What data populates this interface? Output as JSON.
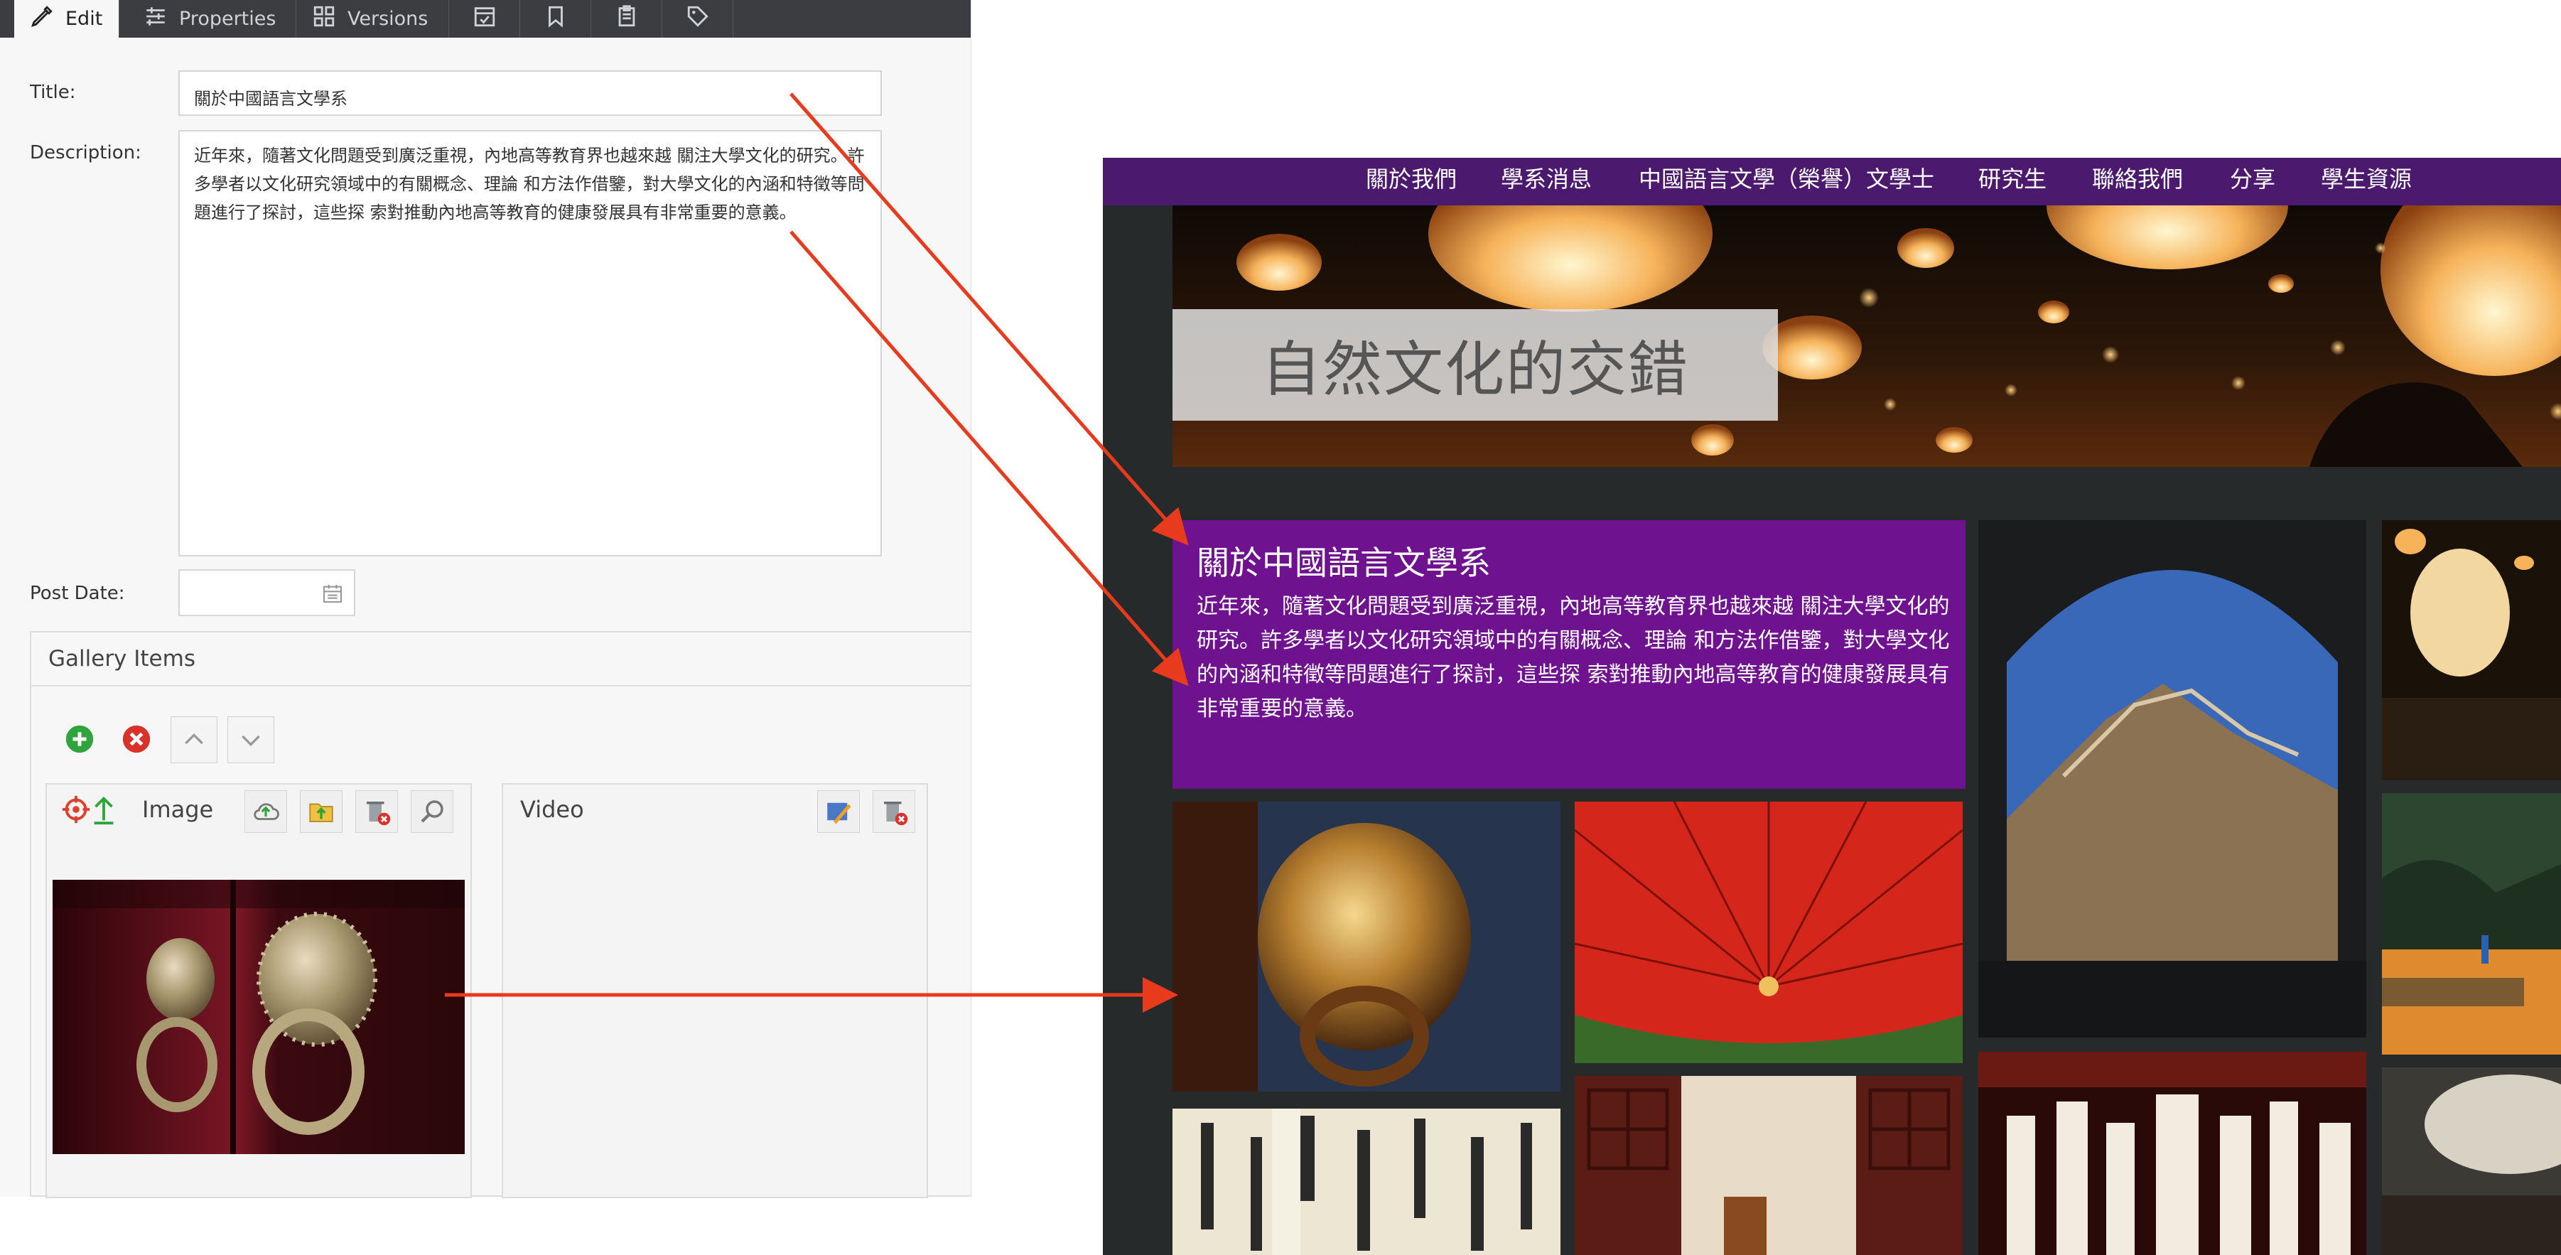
{
  "editor": {
    "tabs": [
      {
        "label": "Edit",
        "icon": "pencil-icon"
      },
      {
        "label": "Properties",
        "icon": "sliders-icon"
      },
      {
        "label": "Versions",
        "icon": "versions-icon"
      },
      {
        "label": "",
        "icon": "calendar-check-icon"
      },
      {
        "label": "",
        "icon": "bookmark-icon"
      },
      {
        "label": "",
        "icon": "clipboard-icon"
      },
      {
        "label": "",
        "icon": "tag-icon"
      }
    ],
    "fields": {
      "title_label": "Title:",
      "title_value": "關於中國語言文學系",
      "description_label": "Description:",
      "description_value": "近年來，隨著文化問題受到廣泛重視，內地高等教育界也越來越 關注大學文化的研究。許多學者以文化研究領域中的有關概念、理論 和方法作借鑒，對大學文化的內涵和特徵等問題進行了探討，這些探 索對推動內地高等教育的健康發展具有非常重要的意義。",
      "post_date_label": "Post Date:",
      "post_date_value": ""
    },
    "gallery": {
      "heading": "Gallery Items",
      "image_card_title": "Image",
      "video_card_title": "Video"
    }
  },
  "site": {
    "nav": [
      "關於我們",
      "學系消息",
      "中國語言文學（榮譽）文學士",
      "研究生",
      "聯絡我們",
      "分享",
      "學生資源"
    ],
    "hero_title": "自然文化的交錯",
    "feature_title": "關於中國語言文學系",
    "feature_text": "近年來，隨著文化問題受到廣泛重視，內地高等教育界也越來越 關注大學文化的研究。許多學者以文化研究領域中的有關概念、理論 和方法作借鑒，對大學文化的內涵和特徵等問題進行了探討，這些探 索對推動內地高等教育的健康發展具有非常重要的意義。",
    "colors": {
      "nav": "#4b1a6e",
      "feature": "#6f1290",
      "arrow": "#e83a1c"
    }
  }
}
